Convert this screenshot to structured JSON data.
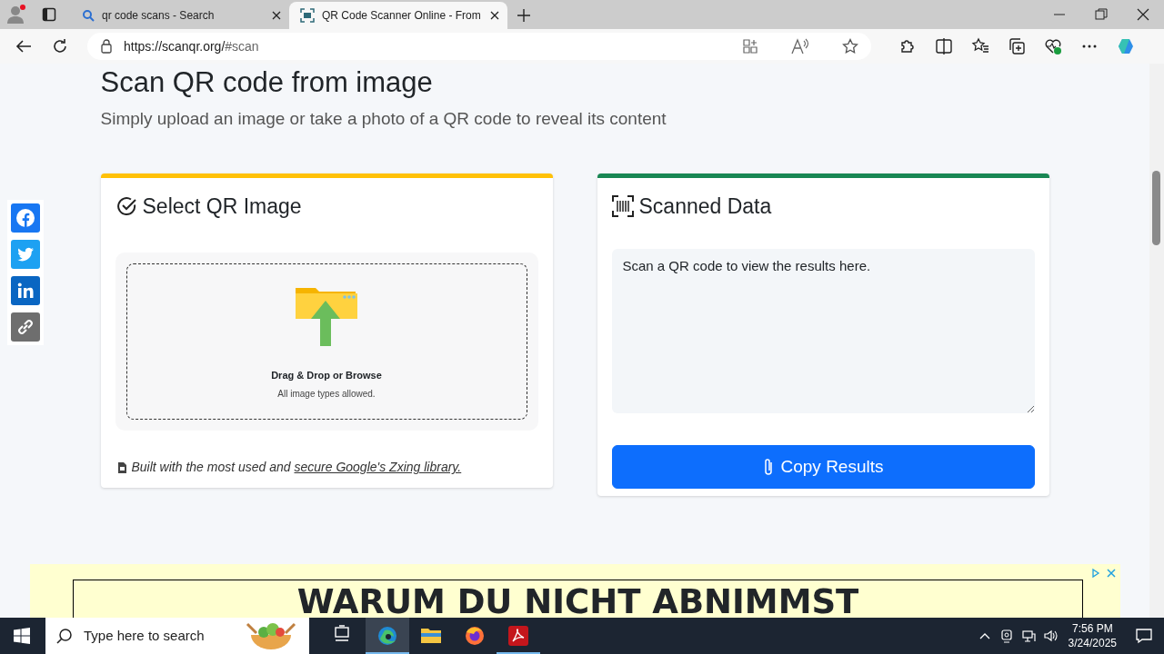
{
  "browser": {
    "tabs": [
      {
        "title": "qr code scans - Search",
        "kind": "search",
        "selected": false
      },
      {
        "title": "QR Code Scanner Online - From",
        "kind": "scanner",
        "selected": true
      }
    ],
    "address_host": "https://scanqr.org/",
    "address_path": "#scan"
  },
  "page": {
    "heading": "Scan QR code from image",
    "subheading": "Simply upload an image or take a photo of a QR code to reveal its content",
    "share": [
      {
        "kind": "facebook",
        "color": "#1877f2"
      },
      {
        "kind": "twitter",
        "color": "#1da1f2"
      },
      {
        "kind": "linkedin",
        "color": "#0a66c2"
      },
      {
        "kind": "link",
        "color": "#6e6e6e"
      }
    ],
    "select_card": {
      "title": "Select QR Image",
      "dropzone_title": "Drag & Drop or Browse",
      "dropzone_hint": "All image types allowed.",
      "footnote": "Built with the most used and ",
      "footnote_link": "secure Google's Zxing library."
    },
    "scanned_card": {
      "title": "Scanned Data",
      "placeholder": "Scan a QR code to view the results here.",
      "button": "Copy Results"
    },
    "ad": {
      "headline": "WARUM DU NICHT ABNIMMST"
    }
  },
  "taskbar": {
    "search_placeholder": "Type here to search",
    "apps": [
      {
        "kind": "taskview",
        "running": false,
        "selected": false
      },
      {
        "kind": "edge",
        "running": true,
        "selected": true
      },
      {
        "kind": "explorer",
        "running": false,
        "selected": false
      },
      {
        "kind": "firefox",
        "running": false,
        "selected": false
      },
      {
        "kind": "acrobat",
        "running": true,
        "selected": false
      }
    ],
    "time": "7:56 PM",
    "date": "3/24/2025"
  }
}
